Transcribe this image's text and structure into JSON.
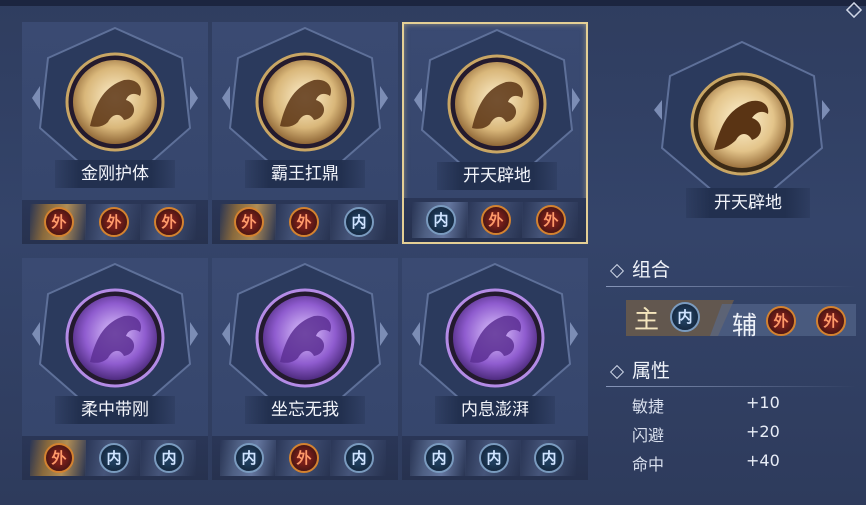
{
  "cards": [
    {
      "name": "金刚护体",
      "element": "gold",
      "badges": [
        "外",
        "外",
        "外"
      ]
    },
    {
      "name": "霸王扛鼎",
      "element": "gold",
      "badges": [
        "外",
        "外",
        "内"
      ]
    },
    {
      "name": "开天辟地",
      "element": "gold",
      "badges": [
        "内",
        "外",
        "外"
      ]
    },
    {
      "name": "柔中带刚",
      "element": "purple",
      "badges": [
        "外",
        "内",
        "内"
      ]
    },
    {
      "name": "坐忘无我",
      "element": "purple",
      "badges": [
        "内",
        "外",
        "内"
      ]
    },
    {
      "name": "内息澎湃",
      "element": "purple",
      "badges": [
        "内",
        "内",
        "内"
      ]
    }
  ],
  "selected_index": 2,
  "detail": {
    "name": "开天辟地",
    "combo_title": "组合",
    "main_label": "主",
    "main_badges": [
      "内"
    ],
    "aux_label": "辅",
    "aux_badges": [
      "外",
      "外"
    ],
    "attr_title": "属性",
    "attrs": [
      {
        "name": "敏捷",
        "value": "+10"
      },
      {
        "name": "闪避",
        "value": "+20"
      },
      {
        "name": "命中",
        "value": "+40"
      }
    ]
  },
  "colors": {
    "gold": "#e4cf95",
    "wai": "#d4822f",
    "nei": "#7a9bbf",
    "purple": "#8a5cc9"
  }
}
